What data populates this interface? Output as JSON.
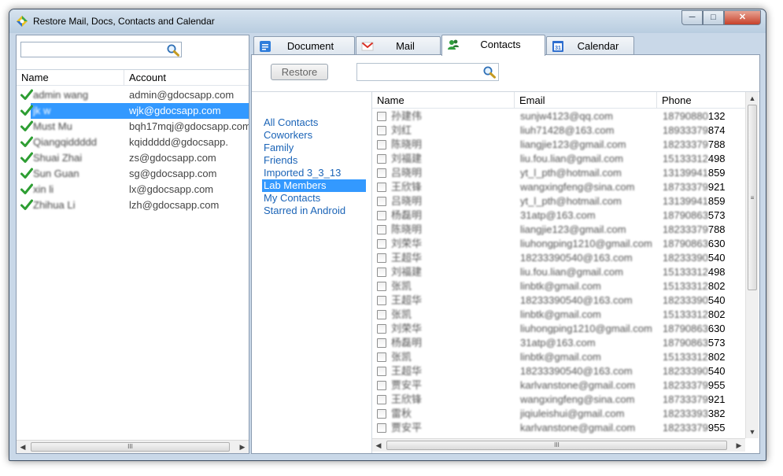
{
  "window": {
    "title": "Restore Mail, Docs, Contacts and Calendar"
  },
  "left": {
    "search": {
      "value": "",
      "placeholder": ""
    },
    "columns": {
      "name": "Name",
      "account": "Account"
    },
    "accounts": [
      {
        "name": "admin wang",
        "email": "admin@gdocsapp.com",
        "selected": false
      },
      {
        "name": "jk w",
        "email": "wjk@gdocsapp.com",
        "selected": true
      },
      {
        "name": "Must Mu",
        "email": "bqh17mqj@gdocsapp.com",
        "selected": false
      },
      {
        "name": "Qiangqiddddd",
        "email": "kqiddddd@gdocsapp.",
        "selected": false
      },
      {
        "name": "Shuai Zhai",
        "email": "zs@gdocsapp.com",
        "selected": false
      },
      {
        "name": "Sun Guan",
        "email": "sg@gdocsapp.com",
        "selected": false
      },
      {
        "name": "xin li",
        "email": "lx@gdocsapp.com",
        "selected": false
      },
      {
        "name": "Zhihua Li",
        "email": "lzh@gdocsapp.com",
        "selected": false
      }
    ],
    "scroll_grip": "III"
  },
  "tabs": [
    {
      "label": "Document",
      "icon": "document-icon",
      "active": false
    },
    {
      "label": "Mail",
      "icon": "gmail-icon",
      "active": false
    },
    {
      "label": "Contacts",
      "icon": "contacts-icon",
      "active": true
    },
    {
      "label": "Calendar",
      "icon": "calendar-icon",
      "active": false
    }
  ],
  "calendar_icon_text": "31",
  "toolbar": {
    "restore_label": "Restore",
    "search_value": ""
  },
  "groups": [
    {
      "label": "All Contacts",
      "active": false
    },
    {
      "label": "Coworkers",
      "active": false
    },
    {
      "label": "Family",
      "active": false
    },
    {
      "label": "Friends",
      "active": false
    },
    {
      "label": "Imported 3_3_13",
      "active": false
    },
    {
      "label": "Lab Members",
      "active": true
    },
    {
      "label": "My Contacts",
      "active": false
    },
    {
      "label": "Starred in Android",
      "active": false
    }
  ],
  "grid": {
    "columns": {
      "name": "Name",
      "email": "Email",
      "phone": "Phone"
    },
    "rows": [
      {
        "name": "孙建伟",
        "email": "sunjw4123@qq.com",
        "phone_prefix": "18790880",
        "phone_suffix": "132"
      },
      {
        "name": "刘红",
        "email": "liuh71428@163.com",
        "phone_prefix": "18933379",
        "phone_suffix": "874"
      },
      {
        "name": "陈晓明",
        "email": "liangjie123@gmail.com",
        "phone_prefix": "18233379",
        "phone_suffix": "788"
      },
      {
        "name": "刘福建",
        "email": "liu.fou.lian@gmail.com",
        "phone_prefix": "15133312",
        "phone_suffix": "498"
      },
      {
        "name": "吕晓明",
        "email": "yt_l_pth@hotmail.com",
        "phone_prefix": "13139941",
        "phone_suffix": "859"
      },
      {
        "name": "王欣锋",
        "email": "wangxingfeng@sina.com",
        "phone_prefix": "18733379",
        "phone_suffix": "921"
      },
      {
        "name": "吕晓明",
        "email": "yt_l_pth@hotmail.com",
        "phone_prefix": "13139941",
        "phone_suffix": "859"
      },
      {
        "name": "杨磊明",
        "email": "31atp@163.com",
        "phone_prefix": "18790863",
        "phone_suffix": "573"
      },
      {
        "name": "陈晓明",
        "email": "liangjie123@gmail.com",
        "phone_prefix": "18233379",
        "phone_suffix": "788"
      },
      {
        "name": "刘荣华",
        "email": "liuhongping1210@gmail.com",
        "phone_prefix": "18790863",
        "phone_suffix": "630"
      },
      {
        "name": "王超华",
        "email": "18233390540@163.com",
        "phone_prefix": "18233390",
        "phone_suffix": "540"
      },
      {
        "name": "刘福建",
        "email": "liu.fou.lian@gmail.com",
        "phone_prefix": "15133312",
        "phone_suffix": "498"
      },
      {
        "name": "张凯",
        "email": "linbtk@gmail.com",
        "phone_prefix": "15133312",
        "phone_suffix": "802"
      },
      {
        "name": "王超华",
        "email": "18233390540@163.com",
        "phone_prefix": "18233390",
        "phone_suffix": "540"
      },
      {
        "name": "张凯",
        "email": "linbtk@gmail.com",
        "phone_prefix": "15133312",
        "phone_suffix": "802"
      },
      {
        "name": "刘荣华",
        "email": "liuhongping1210@gmail.com",
        "phone_prefix": "18790863",
        "phone_suffix": "630"
      },
      {
        "name": "杨磊明",
        "email": "31atp@163.com",
        "phone_prefix": "18790863",
        "phone_suffix": "573"
      },
      {
        "name": "张凯",
        "email": "linbtk@gmail.com",
        "phone_prefix": "15133312",
        "phone_suffix": "802"
      },
      {
        "name": "王超华",
        "email": "18233390540@163.com",
        "phone_prefix": "18233390",
        "phone_suffix": "540"
      },
      {
        "name": "贾安平",
        "email": "karlvanstone@gmail.com",
        "phone_prefix": "18233379",
        "phone_suffix": "955"
      },
      {
        "name": "王欣锋",
        "email": "wangxingfeng@sina.com",
        "phone_prefix": "18733379",
        "phone_suffix": "921"
      },
      {
        "name": "雷秋",
        "email": "jiqiuleishui@gmail.com",
        "phone_prefix": "18233393",
        "phone_suffix": "382"
      },
      {
        "name": "贾安平",
        "email": "karlvanstone@gmail.com",
        "phone_prefix": "18233379",
        "phone_suffix": "955"
      }
    ],
    "scroll_grip": "III",
    "vscroll_grip": "≡"
  },
  "colors": {
    "selection": "#3399ff",
    "link": "#1b64b7",
    "check": "#2e9e33",
    "window_frame": "#c9d8e8"
  }
}
